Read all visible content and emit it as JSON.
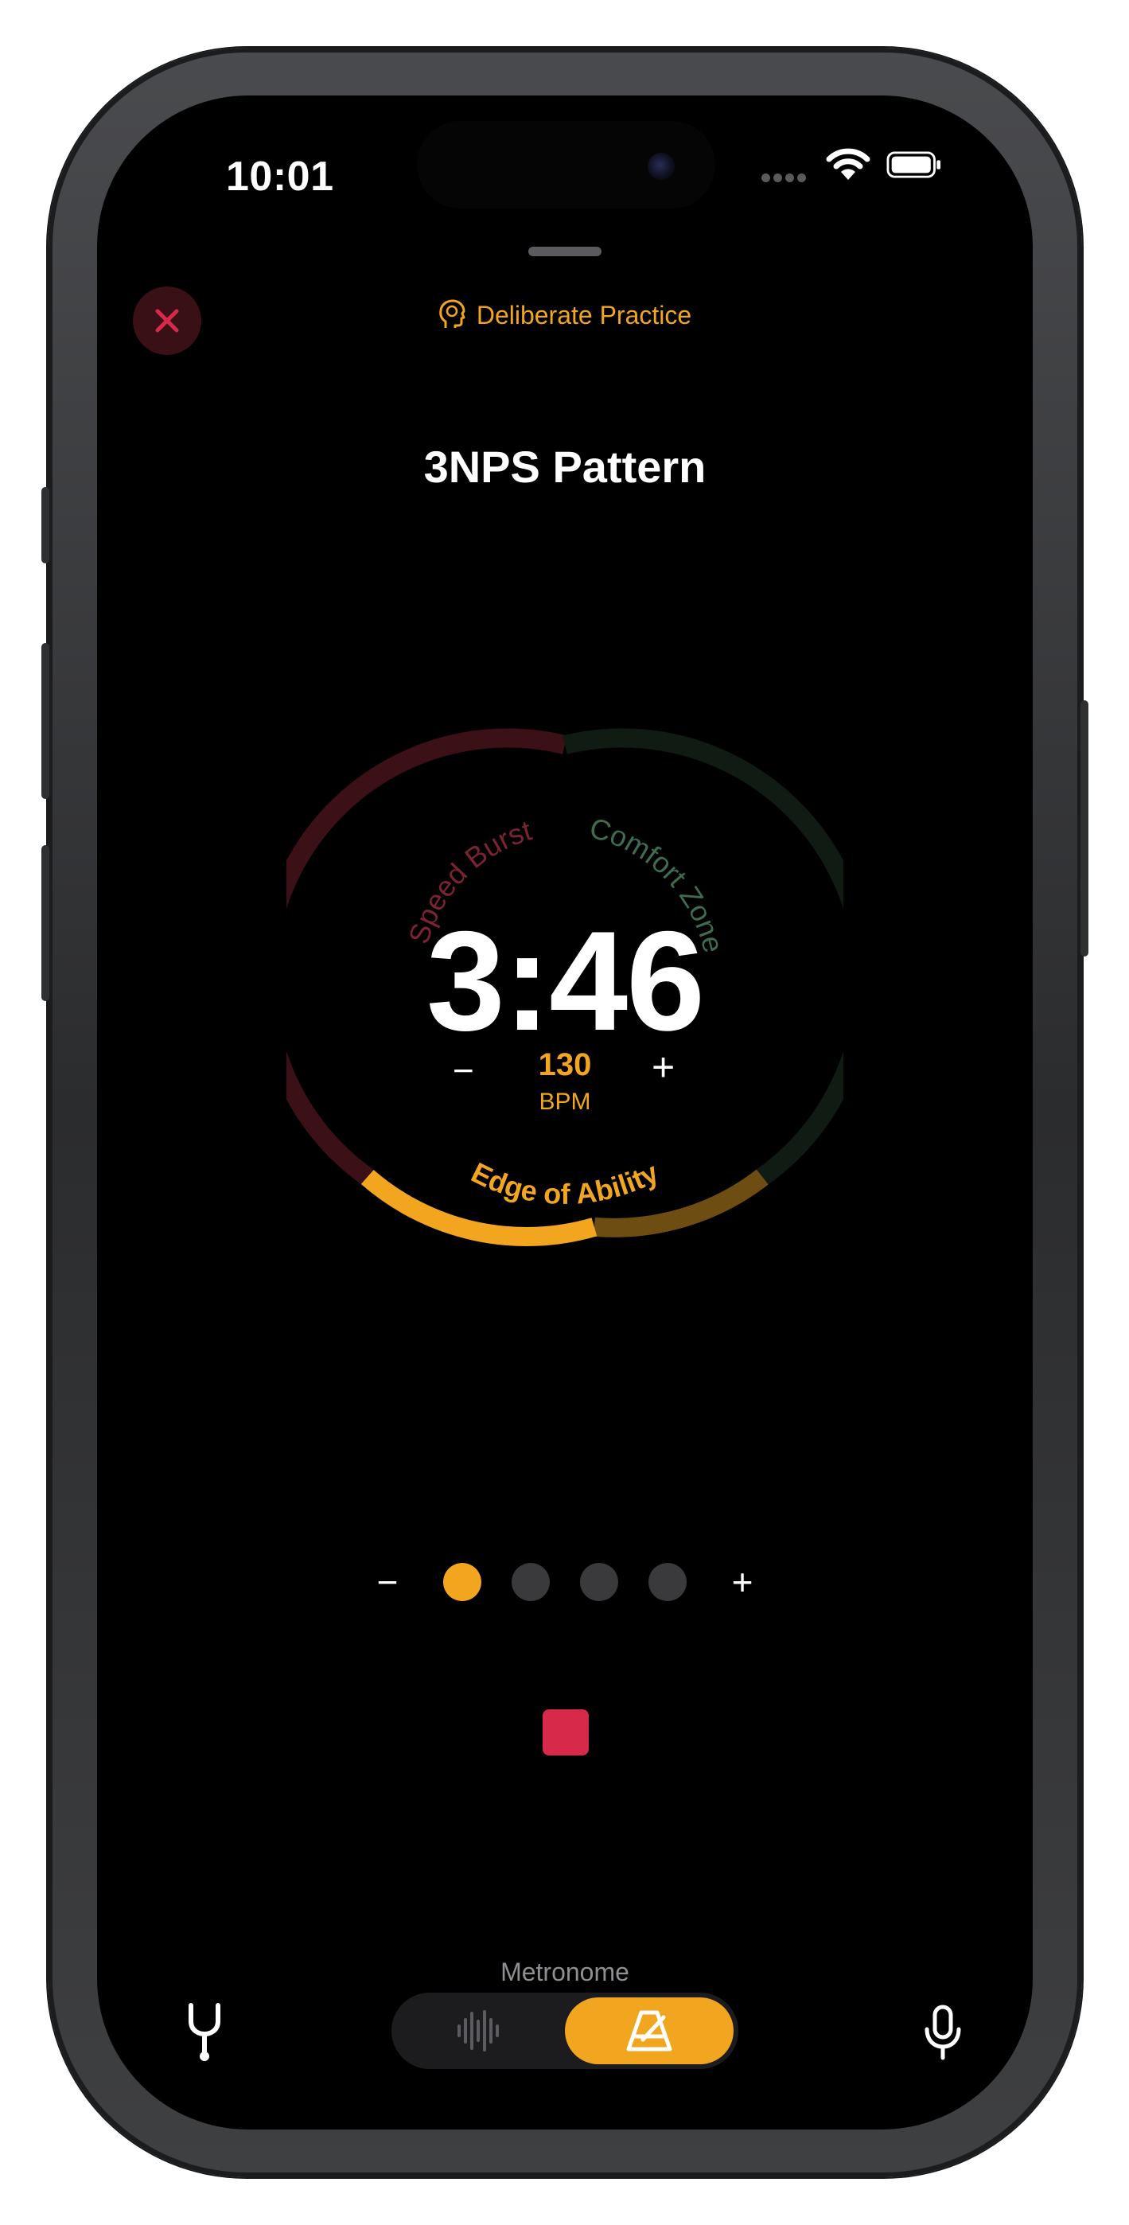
{
  "status_bar": {
    "time": "10:01"
  },
  "header": {
    "mode_label": "Deliberate Practice",
    "mode_icon": "brain-head-icon",
    "close_icon": "close-icon"
  },
  "exercise": {
    "title": "3NPS Pattern"
  },
  "dial": {
    "time_remaining": "3:46",
    "tempo": {
      "value": "130",
      "unit": "BPM",
      "decrease_label": "−",
      "increase_label": "+"
    },
    "zones": {
      "speed_burst": "Speed Burst",
      "comfort_zone": "Comfort Zone",
      "edge_of_ability": "Edge of Ability"
    },
    "colors": {
      "speed_burst": "#3b1016",
      "comfort_zone": "#101b14",
      "edge_active": "#f2a51f",
      "edge_dim": "#6e4d12",
      "speed_burst_text": "#7a2332",
      "comfort_zone_text": "#3f6b4e"
    }
  },
  "beats": {
    "decrease_label": "−",
    "increase_label": "+",
    "count": 4,
    "active_index": 0,
    "active_color": "#f2a51f",
    "inactive_color": "#3a3a3c"
  },
  "playback": {
    "stop_icon": "stop-icon",
    "stop_color": "#d7294a"
  },
  "bottom_bar": {
    "mode_name": "Metronome",
    "left_icon": "tuning-fork-icon",
    "segment_left_icon": "waveform-icon",
    "segment_right_icon": "metronome-icon",
    "right_icon": "microphone-icon"
  },
  "accent_color": "#f2a51f"
}
